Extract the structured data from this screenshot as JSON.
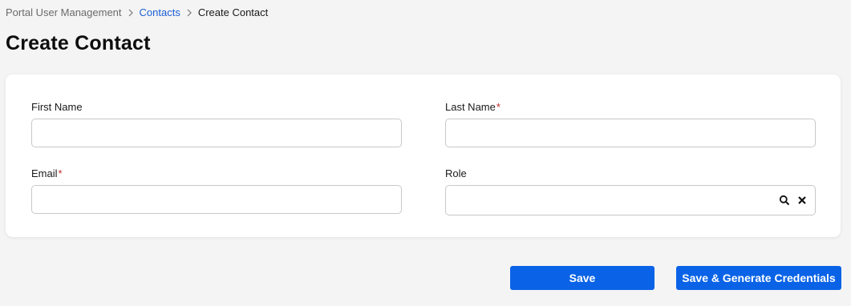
{
  "breadcrumb": {
    "items": [
      "Portal User Management",
      "Contacts",
      "Create Contact"
    ]
  },
  "page": {
    "title": "Create Contact"
  },
  "form": {
    "first_name": {
      "label": "First Name",
      "value": "",
      "required": false
    },
    "last_name": {
      "label": "Last Name",
      "value": "",
      "required": true
    },
    "email": {
      "label": "Email",
      "value": "",
      "required": true
    },
    "role": {
      "label": "Role",
      "value": "",
      "required": false
    },
    "required_marker": "*"
  },
  "icons": {
    "breadcrumb_separator": "chevron-right-icon",
    "role_search": "search-icon",
    "role_clear": "close-icon"
  },
  "actions": {
    "save_label": "Save",
    "save_generate_label": "Save & Generate Credentials"
  },
  "colors": {
    "accent": "#0a63e6",
    "link": "#1a5fd6",
    "required": "#c0262d",
    "background": "#f4f4f4",
    "card": "#ffffff"
  }
}
